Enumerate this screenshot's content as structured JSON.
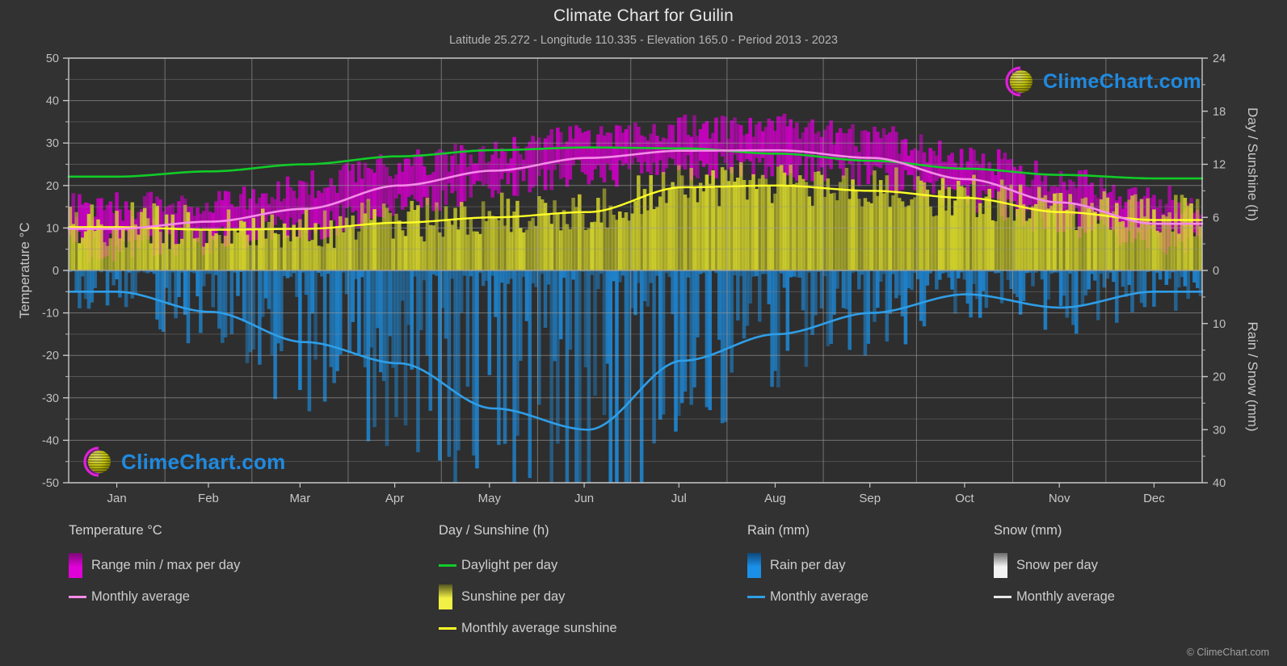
{
  "header": {
    "title": "Climate Chart for Guilin",
    "subtitle": "Latitude 25.272 - Longitude 110.335 - Elevation 165.0 - Period 2013 - 2023"
  },
  "watermark": {
    "text": "ClimeChart.com",
    "ring_color": "#e020d8",
    "sphere_color": "#d4d400",
    "text_color": "#1f8ae0"
  },
  "footer": {
    "copyright": "© ClimeChart.com"
  },
  "colors": {
    "background": "#323232",
    "grid": "#9a9a9a",
    "axis": "#c8c8c8",
    "temp_range": "#e000d8",
    "temp_avg": "#f58ce8",
    "daylight": "#11cc28",
    "sunshine_band": "#e8e838",
    "sunshine_avg": "#ffff28",
    "rain": "#1a8ce0",
    "rain_avg": "#2e9ee8",
    "snow": "#e8e8e8"
  },
  "legend": {
    "groups": [
      {
        "title": "Temperature °C",
        "items": [
          {
            "label": "Range min / max per day",
            "marker": "swatch",
            "color": "#e000d8",
            "color2": "#7a0a74"
          },
          {
            "label": "Monthly average",
            "marker": "line",
            "color": "#f58ce8"
          }
        ]
      },
      {
        "title": "Day / Sunshine (h)",
        "items": [
          {
            "label": "Daylight per day",
            "marker": "line",
            "color": "#11cc28"
          },
          {
            "label": "Sunshine per day",
            "marker": "swatch",
            "color": "#f0f045",
            "color2": "#555520"
          },
          {
            "label": "Monthly average sunshine",
            "marker": "line",
            "color": "#ffff28"
          }
        ]
      },
      {
        "title": "Rain (mm)",
        "items": [
          {
            "label": "Rain per day",
            "marker": "swatch",
            "color": "#1a90e8",
            "color2": "#10487a"
          },
          {
            "label": "Monthly average",
            "marker": "line",
            "color": "#2e9ee8"
          }
        ]
      },
      {
        "title": "Snow (mm)",
        "items": [
          {
            "label": "Snow per day",
            "marker": "swatch",
            "color": "#f2f2f2",
            "color2": "#6a6a6a"
          },
          {
            "label": "Monthly average",
            "marker": "line",
            "color": "#e8e8e8"
          }
        ]
      }
    ]
  },
  "chart_data": {
    "type": "line",
    "title": "Climate Chart for Guilin",
    "subtitle": "Latitude 25.272 - Longitude 110.335 - Elevation 165.0 - Period 2013 - 2023",
    "grid": true,
    "legend_position": "bottom",
    "xlabel": "",
    "categories": [
      "Jan",
      "Feb",
      "Mar",
      "Apr",
      "May",
      "Jun",
      "Jul",
      "Aug",
      "Sep",
      "Oct",
      "Nov",
      "Dec"
    ],
    "axes": {
      "left": {
        "label": "Temperature °C",
        "ticks": [
          50,
          40,
          30,
          20,
          10,
          0,
          -10,
          -20,
          -30,
          -40,
          -50
        ],
        "range": [
          -50,
          50
        ]
      },
      "right_top": {
        "label": "Day / Sunshine (h)",
        "ticks": [
          24,
          18,
          12,
          6,
          0
        ],
        "range": [
          0,
          24
        ]
      },
      "right_bottom": {
        "label": "Rain / Snow (mm)",
        "ticks": [
          0,
          10,
          20,
          30,
          40
        ],
        "range": [
          0,
          40
        ]
      }
    },
    "series": [
      {
        "name": "Monthly average",
        "unit": "°C",
        "axis": "left",
        "color": "#f58ce8",
        "values": [
          9.8,
          11.5,
          14.5,
          20.0,
          23.5,
          26.5,
          28.2,
          28.3,
          26.5,
          21.5,
          16.0,
          11.0
        ]
      },
      {
        "name": "Range min / max per day",
        "unit": "°C",
        "axis": "left",
        "color": "#e000d8",
        "min_values": [
          5.5,
          7.0,
          10.5,
          15.5,
          20.0,
          23.0,
          25.0,
          25.0,
          22.5,
          17.0,
          11.5,
          6.5
        ],
        "max_values": [
          15.0,
          16.5,
          20.0,
          25.0,
          28.0,
          31.0,
          33.5,
          33.5,
          31.0,
          27.0,
          21.5,
          16.5
        ]
      },
      {
        "name": "Daylight per day",
        "unit": "h",
        "axis": "right_top",
        "color": "#11cc28",
        "values": [
          10.6,
          11.2,
          12.0,
          12.9,
          13.6,
          13.9,
          13.8,
          13.2,
          12.4,
          11.5,
          10.8,
          10.4
        ]
      },
      {
        "name": "Monthly average sunshine",
        "unit": "h",
        "axis": "right_top",
        "color": "#ffff28",
        "values": [
          4.9,
          4.6,
          4.7,
          5.4,
          6.0,
          6.6,
          9.4,
          9.6,
          9.0,
          8.2,
          6.6,
          5.7
        ]
      },
      {
        "name": "Monthly average rain",
        "unit": "mm",
        "axis": "right_bottom",
        "color": "#2e9ee8",
        "values": [
          4.0,
          7.8,
          13.5,
          17.5,
          26.0,
          30.0,
          17.0,
          12.0,
          8.0,
          4.5,
          7.0,
          4.0
        ]
      },
      {
        "name": "Monthly average snow",
        "unit": "mm",
        "axis": "right_bottom",
        "color": "#e8e8e8",
        "values": [
          0,
          0,
          0,
          0,
          0,
          0,
          0,
          0,
          0,
          0,
          0,
          0
        ]
      }
    ]
  }
}
